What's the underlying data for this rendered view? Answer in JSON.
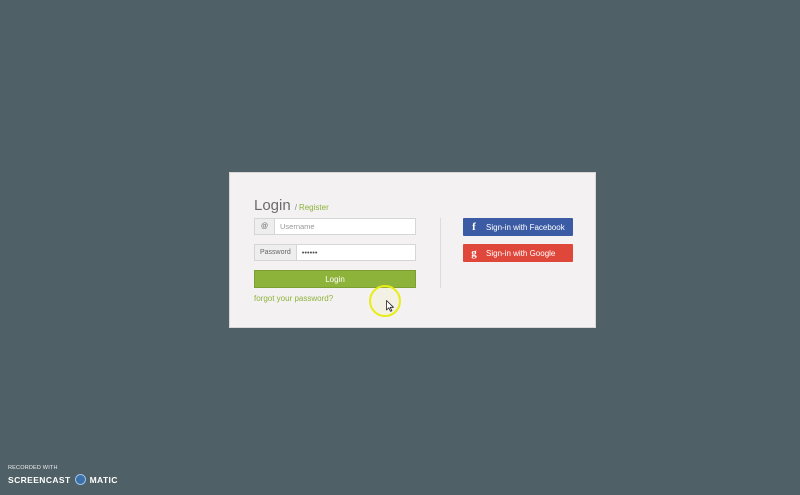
{
  "login_card": {
    "title": "Login",
    "separator": "/",
    "register_link": "Register",
    "username": {
      "addon": "@",
      "placeholder": "Username",
      "value": ""
    },
    "password": {
      "addon": "Password",
      "value": "••••••"
    },
    "login_button": "Login",
    "forgot_link": "forgot your password?"
  },
  "social": {
    "facebook": {
      "icon": "facebook-icon",
      "glyph": "f",
      "label": "Sign-in with Facebook",
      "color": "#3b5ba5"
    },
    "google": {
      "icon": "google-icon",
      "glyph": "g",
      "label": "Sign-in with Google",
      "color": "#e0473b"
    }
  },
  "colors": {
    "background": "#4f6066",
    "accent": "#8db33a"
  },
  "watermark": {
    "recorded_with": "RECORDED WITH",
    "brand_left": "SCREENCAST",
    "brand_right": "MATIC"
  }
}
